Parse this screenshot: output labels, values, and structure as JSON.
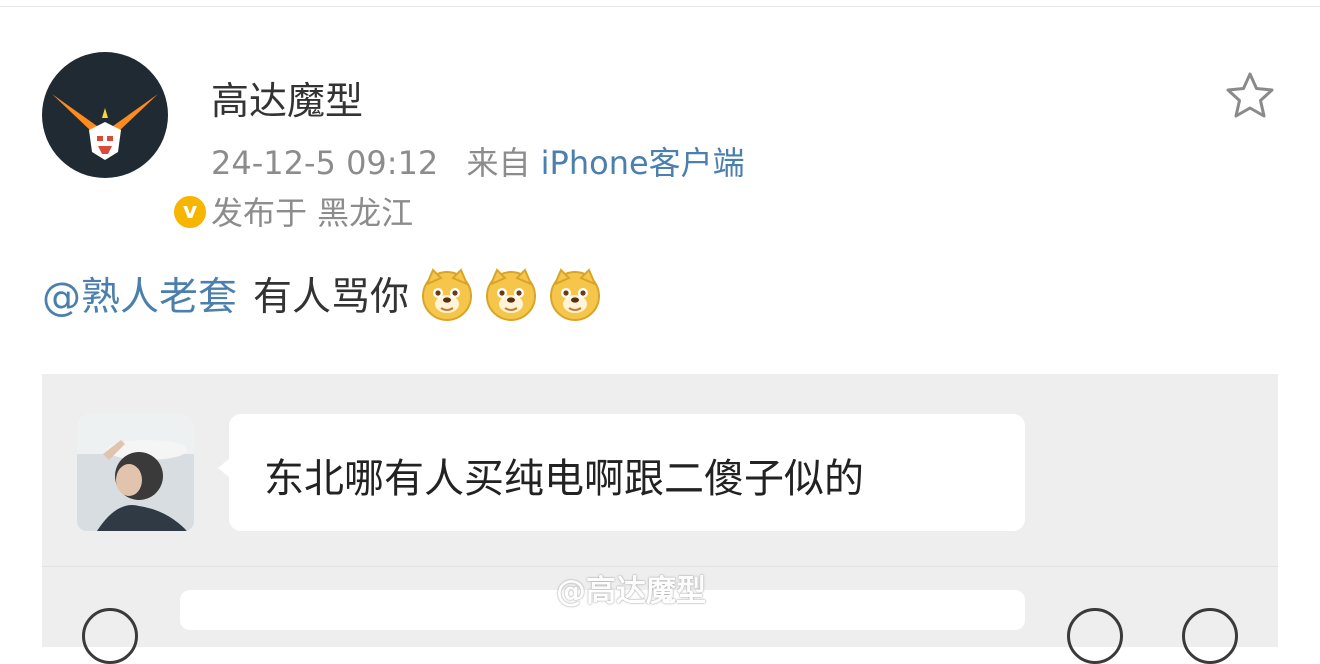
{
  "post": {
    "username": "高达魔型",
    "timestamp": "24-12-5 09:12",
    "from_label": "来自",
    "source": "iPhone客户端",
    "location": "发布于 黑龙江",
    "mention": "@熟人老套",
    "text": "有人骂你",
    "emojis": [
      "doge-emoji",
      "doge-emoji",
      "doge-emoji"
    ]
  },
  "quoted": {
    "message": "东北哪有人买纯电啊跟二傻子似的"
  },
  "watermark": "@高达魔型",
  "colors": {
    "link": "#4b7fad",
    "meta": "#8c8c8c",
    "badge": "#f7b500",
    "card_bg": "#eeeeee"
  }
}
